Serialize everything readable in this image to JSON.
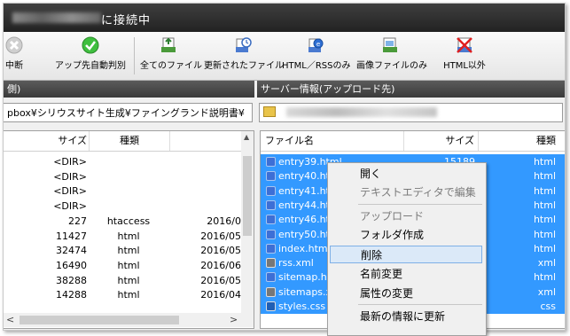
{
  "window": {
    "title_suffix": "に接続中"
  },
  "toolbar": {
    "items": [
      {
        "label": "中断",
        "icon": "stop-icon"
      },
      {
        "label": "アップ先自動判別",
        "icon": "check-icon"
      },
      {
        "label": "全てのファイル",
        "icon": "all-files-icon"
      },
      {
        "label": "更新されたファイル",
        "icon": "updated-files-icon"
      },
      {
        "label": "HTML／RSSのみ",
        "icon": "html-rss-icon"
      },
      {
        "label": "画像ファイルのみ",
        "icon": "image-files-icon"
      },
      {
        "label": "HTML以外",
        "icon": "non-html-icon"
      }
    ]
  },
  "left_pane": {
    "header": "側)",
    "path": "pbox¥シリウスサイト生成¥ファイングランド説明書¥",
    "columns": {
      "size": "サイズ",
      "type": "種類"
    },
    "rows": [
      {
        "size": "<DIR>",
        "type": "",
        "date": ""
      },
      {
        "size": "<DIR>",
        "type": "",
        "date": ""
      },
      {
        "size": "<DIR>",
        "type": "",
        "date": ""
      },
      {
        "size": "<DIR>",
        "type": "",
        "date": ""
      },
      {
        "size": "227",
        "type": "htaccess",
        "date": "2016/0"
      },
      {
        "size": "11427",
        "type": "html",
        "date": "2016/05"
      },
      {
        "size": "32474",
        "type": "html",
        "date": "2016/05"
      },
      {
        "size": "16490",
        "type": "html",
        "date": "2016/06"
      },
      {
        "size": "38288",
        "type": "html",
        "date": "2016/05"
      },
      {
        "size": "14288",
        "type": "html",
        "date": "2016/04"
      }
    ],
    "scroll_left": "<",
    "scroll_right": ">"
  },
  "right_pane": {
    "header": "サーバー情報(アップロード先)",
    "columns": {
      "name": "ファイル名",
      "size": "サイズ",
      "type": "種類"
    },
    "rows": [
      {
        "name": "entry39.html",
        "size": "15189",
        "type": "html",
        "kind": "html"
      },
      {
        "name": "entry40.htm",
        "size": "",
        "type": "html",
        "kind": "html"
      },
      {
        "name": "entry41.htm",
        "size": "",
        "type": "html",
        "kind": "html"
      },
      {
        "name": "entry44.htm",
        "size": "",
        "type": "html",
        "kind": "html"
      },
      {
        "name": "entry46.htm",
        "size": "",
        "type": "html",
        "kind": "html"
      },
      {
        "name": "entry50.htm",
        "size": "",
        "type": "html",
        "kind": "html"
      },
      {
        "name": "index.html",
        "size": "",
        "type": "html",
        "kind": "html"
      },
      {
        "name": "rss.xml",
        "size": "",
        "type": "xml",
        "kind": "xml"
      },
      {
        "name": "sitemap.htr",
        "size": "",
        "type": "html",
        "kind": "html"
      },
      {
        "name": "sitemaps.xı",
        "size": "",
        "type": "xml",
        "kind": "xml"
      },
      {
        "name": "styles.css",
        "size": "",
        "type": "css",
        "kind": "css"
      }
    ]
  },
  "context_menu": {
    "items": [
      {
        "label": "開く",
        "disabled": false
      },
      {
        "label": "テキストエディタで編集",
        "disabled": true
      },
      {
        "label": "アップロード",
        "disabled": true
      },
      {
        "label": "フォルダ作成",
        "disabled": false
      },
      {
        "label": "削除",
        "disabled": false,
        "highlighted": true
      },
      {
        "label": "名前変更",
        "disabled": false
      },
      {
        "label": "属性の変更",
        "disabled": false
      },
      {
        "label": "最新の情報に更新",
        "disabled": false
      }
    ]
  }
}
